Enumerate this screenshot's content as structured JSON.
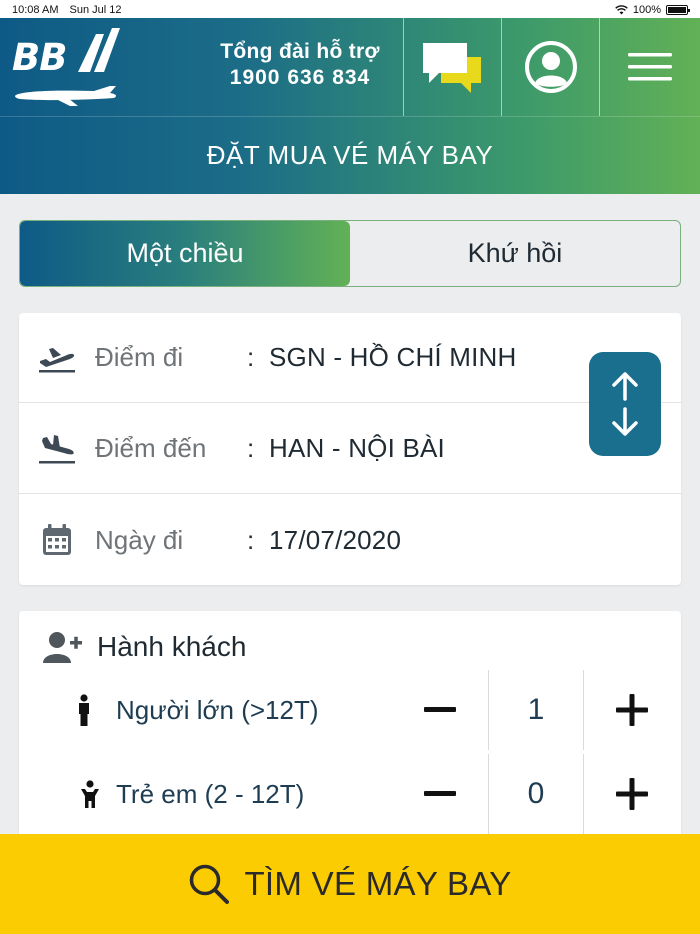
{
  "status_bar": {
    "time": "10:08 AM",
    "date": "Sun Jul 12",
    "battery": "100%"
  },
  "header": {
    "logo_text": "BB",
    "hotline_label": "Tổng đài hỗ trợ",
    "hotline_number": "1900 636 834",
    "icons": [
      "chat-icon",
      "user-icon",
      "menu-icon"
    ],
    "title": "ĐẶT MUA VÉ MÁY BAY"
  },
  "trip_type": {
    "options": [
      {
        "label": "Một chiều",
        "selected": true
      },
      {
        "label": "Khứ hồi",
        "selected": false
      }
    ]
  },
  "route": {
    "departure": {
      "label": "Điểm đi",
      "value": "SGN - HỒ CHÍ MINH"
    },
    "arrival": {
      "label": "Điểm đến",
      "value": "HAN - NỘI BÀI"
    },
    "date": {
      "label": "Ngày đi",
      "value": "17/07/2020"
    },
    "colon": ":"
  },
  "passengers": {
    "title": "Hành khách",
    "rows": [
      {
        "label": "Người lớn (>12T)",
        "count": "1"
      },
      {
        "label": "Trẻ em (2 - 12T)",
        "count": "0"
      }
    ]
  },
  "search": {
    "label": "TÌM VÉ MÁY BAY"
  },
  "colors": {
    "brand_blue": "#0e5a86",
    "brand_green": "#62b156",
    "swap_button": "#1b6f8e",
    "search_yellow": "#fccc02",
    "chat_accent": "#e8d91a"
  }
}
